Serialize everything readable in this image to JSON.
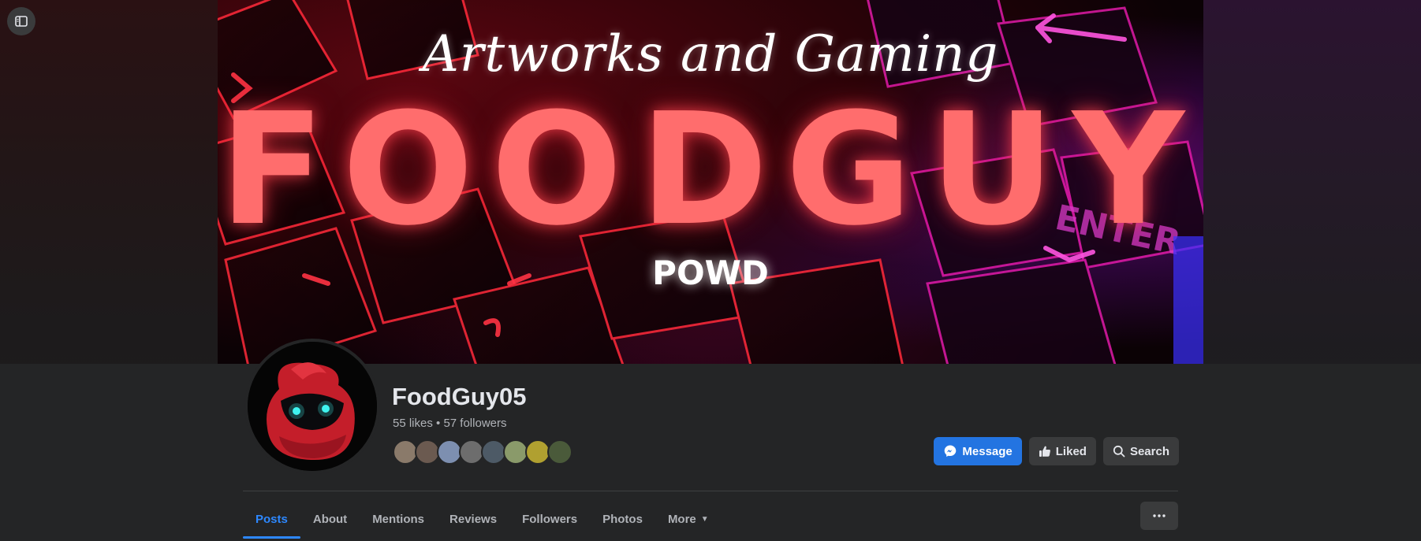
{
  "cover": {
    "script_text": "Artworks and Gaming",
    "title": "FOODGUY",
    "subtitle": "POWD"
  },
  "page": {
    "name": "FoodGuy05",
    "stats": "55 likes • 57 followers"
  },
  "friends": [
    {
      "color": "#8a7a6a"
    },
    {
      "color": "#6b5a50"
    },
    {
      "color": "#7d8fb0"
    },
    {
      "color": "#6d6d6d"
    },
    {
      "color": "#4d5a66"
    },
    {
      "color": "#8a9a6a"
    },
    {
      "color": "#b0a030"
    },
    {
      "color": "#4a5a3a"
    }
  ],
  "actions": {
    "message": "Message",
    "liked": "Liked",
    "search": "Search"
  },
  "tabs": [
    {
      "label": "Posts",
      "active": true
    },
    {
      "label": "About"
    },
    {
      "label": "Mentions"
    },
    {
      "label": "Reviews"
    },
    {
      "label": "Followers"
    },
    {
      "label": "Photos"
    },
    {
      "label": "More"
    }
  ],
  "colors": {
    "accent": "#2d88ff",
    "primary_button": "#2374e1",
    "cover_title": "#ff6d6d"
  },
  "icons": [
    "sidebar-toggle-icon",
    "messenger-icon",
    "thumbs-up-icon",
    "search-icon",
    "caret-down-icon",
    "ellipsis-icon"
  ]
}
